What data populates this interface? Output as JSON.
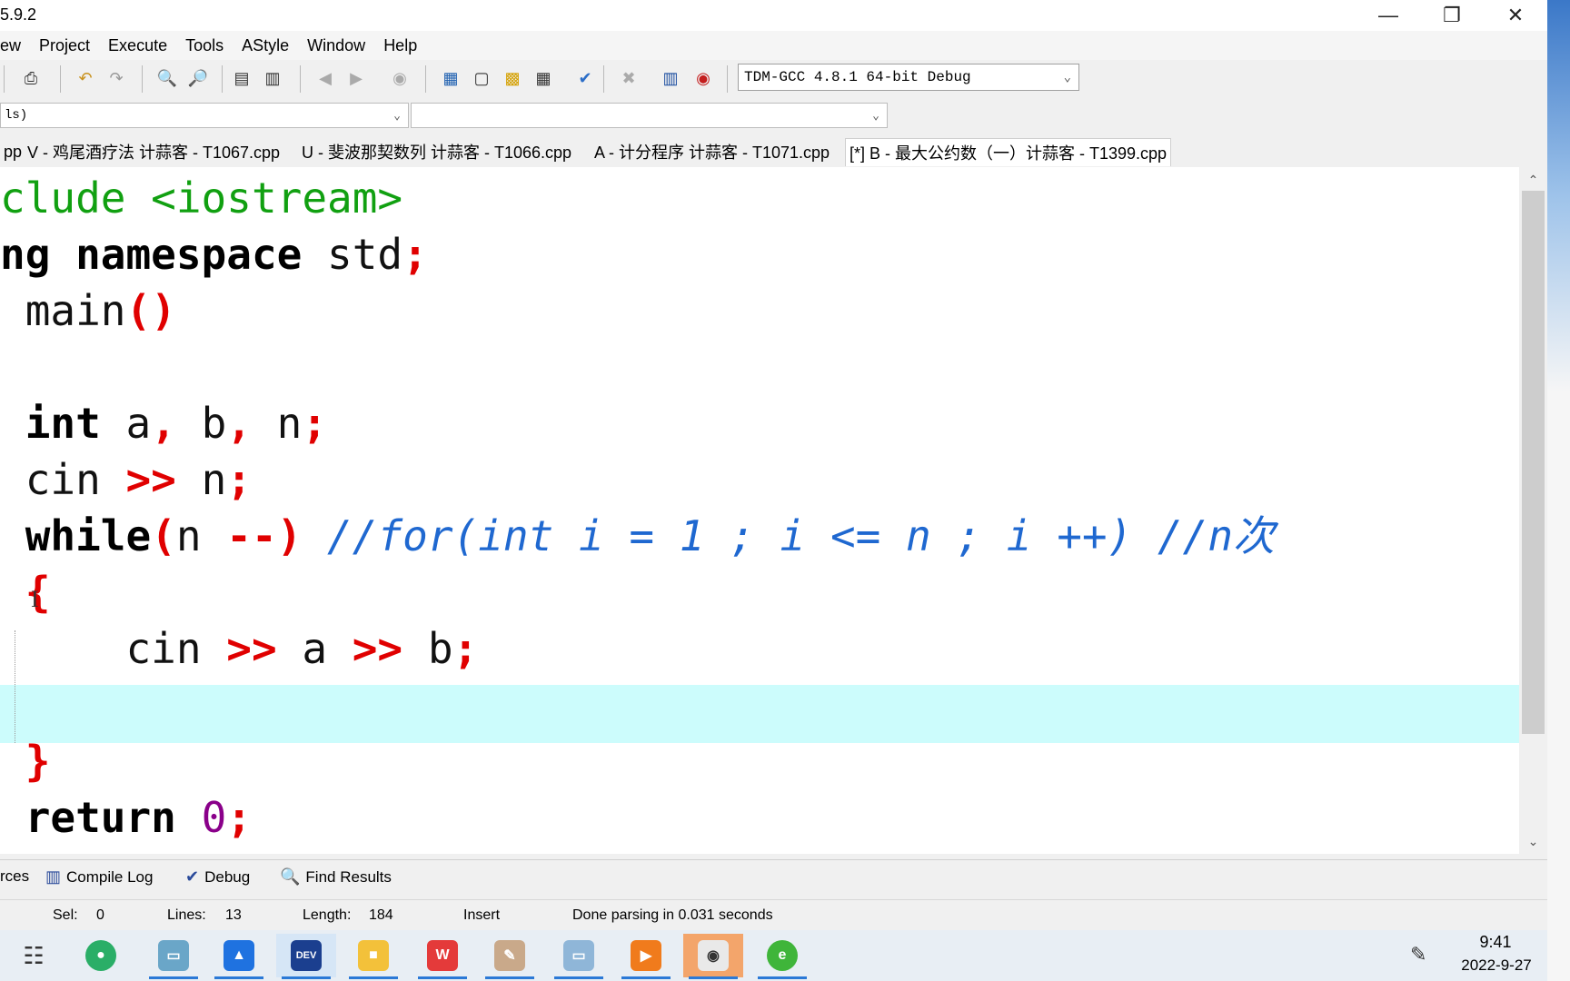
{
  "window": {
    "title": "5.9.2"
  },
  "menu": [
    "ew",
    "Project",
    "Execute",
    "Tools",
    "AStyle",
    "Window",
    "Help"
  ],
  "toolbar": {
    "compiler": "TDM-GCC 4.8.1 64-bit Debug"
  },
  "classbar": {
    "left_value": "ls)",
    "right_value": ""
  },
  "tabs": [
    {
      "label": "pp",
      "active": false
    },
    {
      "label": "V - 鸡尾酒疗法 计蒜客 - T1067.cpp",
      "active": false
    },
    {
      "label": "U - 斐波那契数列 计蒜客 - T1066.cpp",
      "active": false
    },
    {
      "label": "A - 计分程序 计蒜客 - T1071.cpp",
      "active": false
    },
    {
      "label": "[*] B - 最大公约数（一）计蒜客 - T1399.cpp",
      "active": true
    }
  ],
  "code": {
    "l1_a": "clude ",
    "l1_b": "<iostream>",
    "l2_a": "ng namespace",
    "l2_b": " std",
    "l2_c": ";",
    "l3_a": " main",
    "l3_b": "()",
    "l5_a": " int",
    "l5_b": " a",
    "l5_c": ",",
    "l5_d": " b",
    "l5_e": ",",
    "l5_f": " n",
    "l5_g": ";",
    "l6_a": " cin ",
    "l6_b": ">>",
    "l6_c": " n",
    "l6_d": ";",
    "l7_a": " while",
    "l7_b": "(",
    "l7_c": "n ",
    "l7_d": "--)",
    "l7_e": " //for(int i = 1 ; i <= n ; i ++) //n次",
    "l8_a": " {",
    "l9_a": "     cin ",
    "l9_b": ">>",
    "l9_c": " a ",
    "l9_d": ">>",
    "l9_e": " b",
    "l9_f": ";",
    "l11_a": " }",
    "l12_a": " return ",
    "l12_b": "0",
    "l12_c": ";"
  },
  "bottom_tabs": [
    "rces",
    "Compile Log",
    "Debug",
    "Find Results"
  ],
  "status": {
    "sel_label": "Sel:",
    "sel_value": "0",
    "lines_label": "Lines:",
    "lines_value": "13",
    "length_label": "Length:",
    "length_value": "184",
    "mode": "Insert",
    "message": "Done parsing in 0.031 seconds"
  },
  "taskbar": {
    "apps": [
      "task-view",
      "wechat",
      "app-3",
      "meeting",
      "dev-cpp",
      "file-explorer",
      "wps",
      "paint",
      "app-9",
      "slides",
      "screen-recorder",
      "browser"
    ],
    "dev_icon_text": "DEV",
    "time": "9:41",
    "date": "2022-9-27"
  },
  "colors": {
    "current_line": "#ccfcfc",
    "keyword_symbol": "#e00000",
    "preprocessor": "#11a011",
    "comment": "#1f68d0",
    "number": "#8a008a"
  }
}
